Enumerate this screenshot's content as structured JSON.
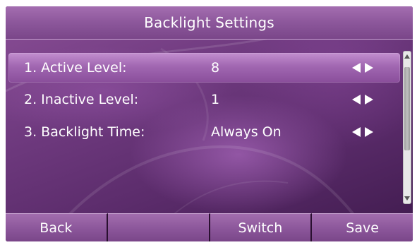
{
  "screen": {
    "title": "Backlight Settings"
  },
  "settings": [
    {
      "label": "1. Active Level:",
      "value": "8",
      "selected": true
    },
    {
      "label": "2. Inactive Level:",
      "value": "1",
      "selected": false
    },
    {
      "label": "3. Backlight Time:",
      "value": "Always On",
      "selected": false
    }
  ],
  "icons": {
    "left": "arrow-left-icon",
    "right": "arrow-right-icon",
    "scroll_up": "scroll-up-icon",
    "scroll_down": "scroll-down-icon"
  },
  "softkeys": {
    "key1": "Back",
    "key2": "",
    "key3": "Switch",
    "key4": "Save"
  },
  "colors": {
    "theme": "#8c579b",
    "text": "#ffffff",
    "selection": "#a167b1"
  }
}
